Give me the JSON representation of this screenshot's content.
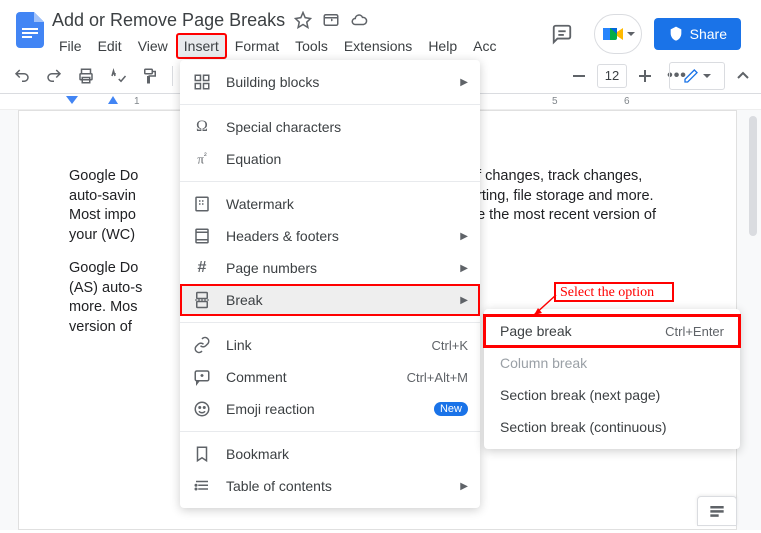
{
  "header": {
    "title": "Add or Remove Page Breaks",
    "share_label": "Share"
  },
  "menubar": [
    "File",
    "Edit",
    "View",
    "Insert",
    "Format",
    "Tools",
    "Extensions",
    "Help",
    "Acc"
  ],
  "menubar_selected_index": 3,
  "toolbar": {
    "zoom_value": "12"
  },
  "ruler": {
    "ticks": [
      "1",
      "5",
      "6"
    ]
  },
  "document": {
    "paragraphs": [
      "Google Do\nauto-savin\nMost impo\nyour (WC)",
      "Google Do\n(AS) auto-s\nmore. Mos\nversion of"
    ],
    "right_fragments": [
      "of changes, track changes,",
      "orting, file storage and more.",
      "ee the most recent version of"
    ]
  },
  "insert_menu": {
    "groups": [
      [
        {
          "icon": "building-blocks-icon",
          "label": "Building blocks",
          "submenu": true
        }
      ],
      [
        {
          "icon": "omega-icon",
          "label": "Special characters"
        },
        {
          "icon": "pi-icon",
          "label": "Equation"
        }
      ],
      [
        {
          "icon": "watermark-icon",
          "label": "Watermark"
        },
        {
          "icon": "headers-footers-icon",
          "label": "Headers & footers",
          "submenu": true
        },
        {
          "icon": "page-numbers-icon",
          "label": "Page numbers",
          "submenu": true
        },
        {
          "icon": "break-icon",
          "label": "Break",
          "submenu": true,
          "hover": true,
          "boxed": true
        }
      ],
      [
        {
          "icon": "link-icon",
          "label": "Link",
          "shortcut": "Ctrl+K"
        },
        {
          "icon": "comment-icon",
          "label": "Comment",
          "shortcut": "Ctrl+Alt+M"
        },
        {
          "icon": "emoji-icon",
          "label": "Emoji reaction",
          "badge": "New"
        }
      ],
      [
        {
          "icon": "bookmark-icon",
          "label": "Bookmark"
        },
        {
          "icon": "toc-icon",
          "label": "Table of contents",
          "submenu": true
        }
      ]
    ]
  },
  "break_submenu": [
    {
      "label": "Page break",
      "shortcut": "Ctrl+Enter",
      "boxed": true
    },
    {
      "label": "Column break",
      "disabled": true
    },
    {
      "label": "Section break (next page)"
    },
    {
      "label": "Section break (continuous)"
    }
  ],
  "annotation": {
    "text": "Select the option"
  }
}
